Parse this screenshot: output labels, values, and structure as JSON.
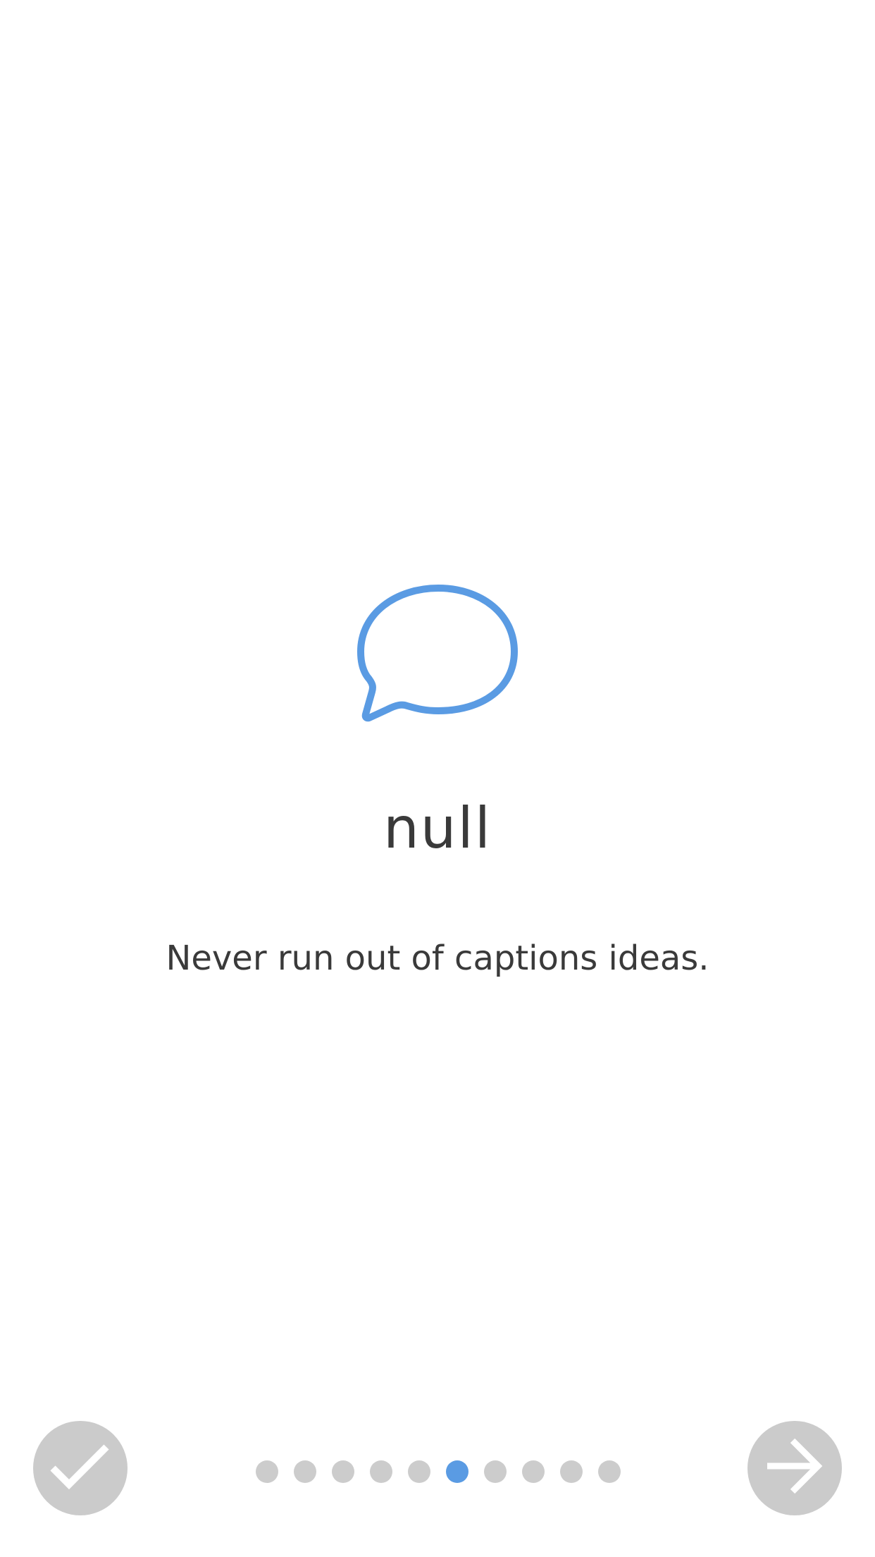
{
  "onboarding": {
    "title": "null",
    "subtitle": "Never run out of captions ideas."
  },
  "icons": {
    "hero": "speech-bubble-icon",
    "done": "checkmark-icon",
    "next": "arrow-right-icon"
  },
  "pagination": {
    "total": 10,
    "current_index": 5
  },
  "colors": {
    "accent": "#5a9be3",
    "button_fill": "#cbcbcb",
    "dot_inactive": "#cccccc",
    "text": "#3a3a3a",
    "background": "#ffffff"
  }
}
